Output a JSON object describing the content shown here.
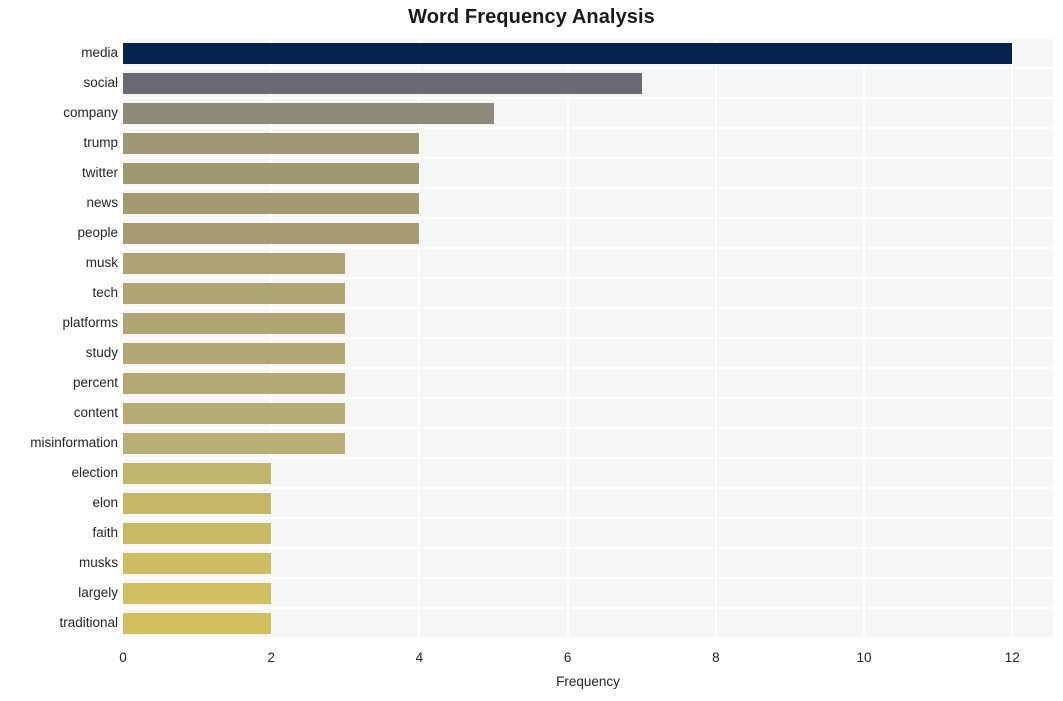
{
  "chart_data": {
    "type": "bar",
    "orientation": "horizontal",
    "title": "Word Frequency Analysis",
    "xlabel": "Frequency",
    "ylabel": "",
    "xlim": [
      0,
      12.55
    ],
    "xticks": [
      0,
      2,
      4,
      6,
      8,
      10,
      12
    ],
    "xtick_labels": [
      "0",
      "2",
      "4",
      "6",
      "8",
      "10",
      "12"
    ],
    "grid": true,
    "legend": false,
    "categories": [
      "media",
      "social",
      "company",
      "trump",
      "twitter",
      "news",
      "people",
      "musk",
      "tech",
      "platforms",
      "study",
      "percent",
      "content",
      "misinformation",
      "election",
      "elon",
      "faith",
      "musks",
      "largely",
      "traditional"
    ],
    "values": [
      12,
      7,
      5,
      4,
      4,
      4,
      4,
      3,
      3,
      3,
      3,
      3,
      3,
      3,
      2,
      2,
      2,
      2,
      2,
      2
    ],
    "bar_colors": [
      "#04244e",
      "#6a6b72",
      "#8e8a7a",
      "#9e9674",
      "#a09872",
      "#a39a72",
      "#a59c72",
      "#aca273",
      "#aea474",
      "#b0a675",
      "#b2a875",
      "#b4aa75",
      "#b6ac76",
      "#b8ae76",
      "#c1b56c",
      "#c5b869",
      "#c8bb66",
      "#ccbd63",
      "#cfbf61",
      "#d2bf5f"
    ],
    "plot_background": "#f6f6f6",
    "figure_background": "#ffffff",
    "gridline_color": "#ffffff",
    "text_color": "#262626"
  }
}
